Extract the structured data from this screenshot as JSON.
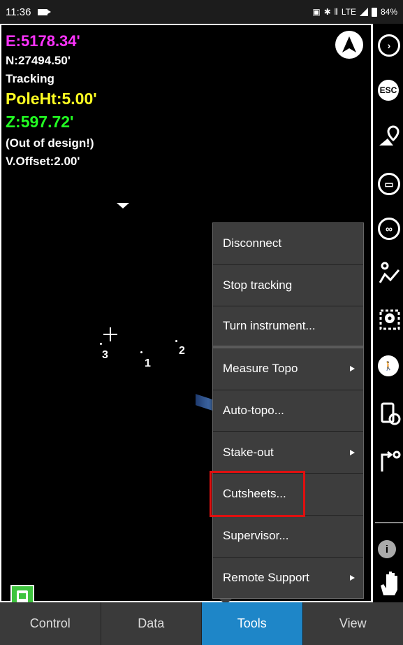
{
  "status_bar": {
    "time": "11:36",
    "right_text": "LTE",
    "battery": "84%"
  },
  "readout": {
    "easting": "E:5178.34'",
    "northing": "N:27494.50'",
    "mode": "Tracking",
    "pole_height": "PoleHt:5.00'",
    "elevation": "Z:597.72'",
    "design_status": "(Out of design!)",
    "vertical_offset": "V.Offset:2.00'"
  },
  "map": {
    "points": [
      {
        "label": "3"
      },
      {
        "label": "1"
      },
      {
        "label": "2"
      }
    ]
  },
  "menu": {
    "items": [
      {
        "label": "Disconnect",
        "submenu": false
      },
      {
        "label": "Stop tracking",
        "submenu": false
      },
      {
        "label": "Turn instrument...",
        "submenu": false
      },
      {
        "label": "Measure Topo",
        "submenu": true
      },
      {
        "label": "Auto-topo...",
        "submenu": false
      },
      {
        "label": "Stake-out",
        "submenu": true
      },
      {
        "label": "Cutsheets...",
        "submenu": false,
        "highlighted": true
      },
      {
        "label": "Supervisor...",
        "submenu": false
      },
      {
        "label": "Remote Support",
        "submenu": true
      }
    ]
  },
  "toolbar": {
    "esc_label": "ESC",
    "info_label": "i",
    "icons": [
      "next-icon",
      "esc-icon",
      "map-pin-icon",
      "zoom-extents-icon",
      "zoom-infinity-icon",
      "polyline-icon",
      "point-icon",
      "walk-icon",
      "instrument-settings-icon",
      "route-icon",
      "info-icon",
      "hand-pan-icon"
    ]
  },
  "tabs": [
    {
      "label": "Control",
      "active": false
    },
    {
      "label": "Data",
      "active": false
    },
    {
      "label": "Tools",
      "active": true
    },
    {
      "label": "View",
      "active": false
    }
  ],
  "colors": {
    "easting": "#ff33ff",
    "pole_height": "#ffff22",
    "elevation": "#22ff22",
    "tab_active": "#1e86c8",
    "highlight": "#e01010",
    "instrument_button": "#3fc43f"
  }
}
